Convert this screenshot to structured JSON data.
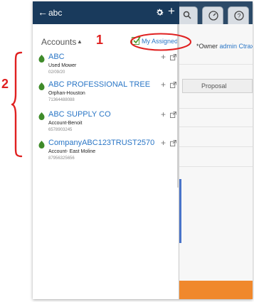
{
  "header": {
    "back_glyph": "←",
    "search_text": "abc",
    "settings_icon": "gear-icon",
    "add_glyph": "+"
  },
  "filter": {
    "accounts_label": "Accounts",
    "sort_glyph": "▲",
    "my_assigned_label": "My Assigned",
    "my_assigned_checked": true
  },
  "accounts": [
    {
      "name": "ABC",
      "subtitle": "Used Mower",
      "meta": "02/09/20"
    },
    {
      "name": "ABC PROFESSIONAL TREE",
      "subtitle": "Orphan-Houston",
      "meta": "71364488088"
    },
    {
      "name": "ABC SUPPLY CO",
      "subtitle": "Account-Benoit",
      "meta": "6578903245"
    },
    {
      "name": "CompanyABC123TRUST2570",
      "subtitle": "Account- East Moline",
      "meta": "87956325656"
    }
  ],
  "account_actions": {
    "add_glyph": "+",
    "open_icon": "external-link-icon"
  },
  "background": {
    "owner_label": "*Owner",
    "owner_value": "admin Ctrax",
    "stage": "Proposal"
  },
  "annotations": {
    "one": "1",
    "two": "2"
  },
  "colors": {
    "header": "#193a5c",
    "link": "#2a76c6",
    "annotation": "#e02020",
    "account_icon": "#3f8b2a",
    "orange_bar": "#f0882c"
  }
}
